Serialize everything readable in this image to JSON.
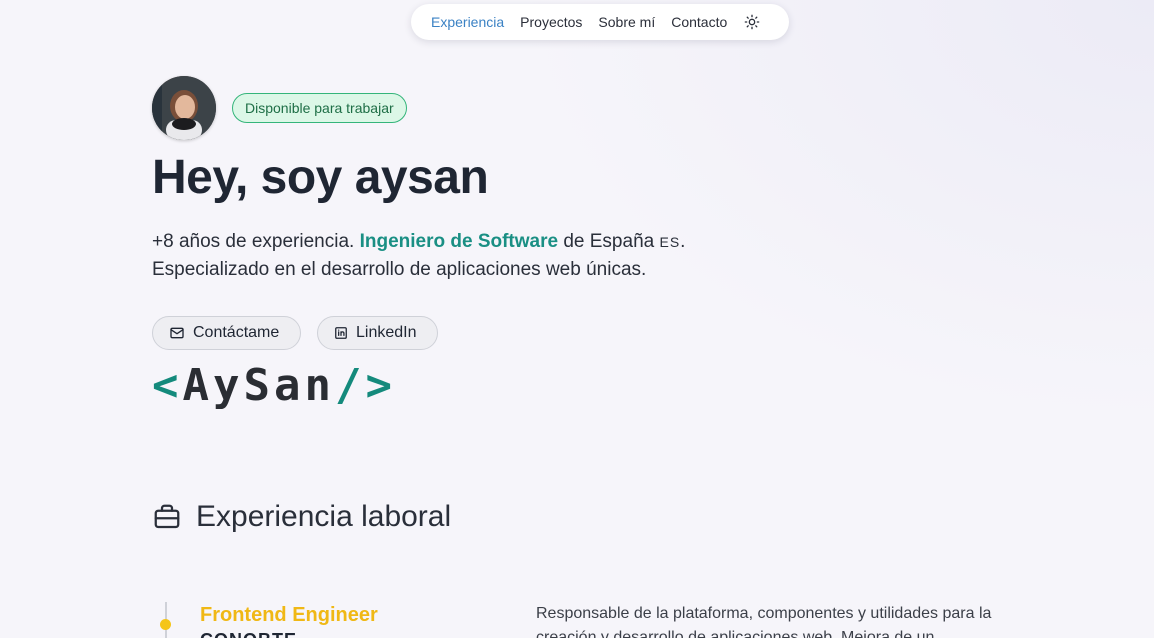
{
  "nav": {
    "items": [
      {
        "label": "Experiencia",
        "active": true
      },
      {
        "label": "Proyectos",
        "active": false
      },
      {
        "label": "Sobre mí",
        "active": false
      },
      {
        "label": "Contacto",
        "active": false
      }
    ],
    "theme_icon": "sun-icon"
  },
  "hero": {
    "badge": "Disponible para trabajar",
    "title": "Hey, soy aysan",
    "desc_prefix": "+8 años de experiencia.",
    "desc_highlight": "Ingeniero de Software",
    "desc_middle": "de España",
    "desc_flag": "ES",
    "desc_suffix": ".",
    "desc_line2": "Especializado en el desarrollo de aplicaciones web únicas.",
    "buttons": {
      "contact": "Contáctame",
      "linkedin": "LinkedIn"
    },
    "logo": {
      "open": "<",
      "name": "AySan",
      "close": "/>"
    }
  },
  "experience": {
    "title": "Experiencia laboral",
    "jobs": [
      {
        "title": "Frontend Engineer",
        "company": "CONOBTE",
        "description": "Responsable de la plataforma, componentes y utilidades para la creación y desarrollo de aplicaciones web. Mejora de un"
      }
    ]
  },
  "colors": {
    "accent_teal": "#1a8f84",
    "accent_yellow": "#f0b815",
    "nav_active": "#3b82c4",
    "badge_bg": "#dcf7e7"
  }
}
